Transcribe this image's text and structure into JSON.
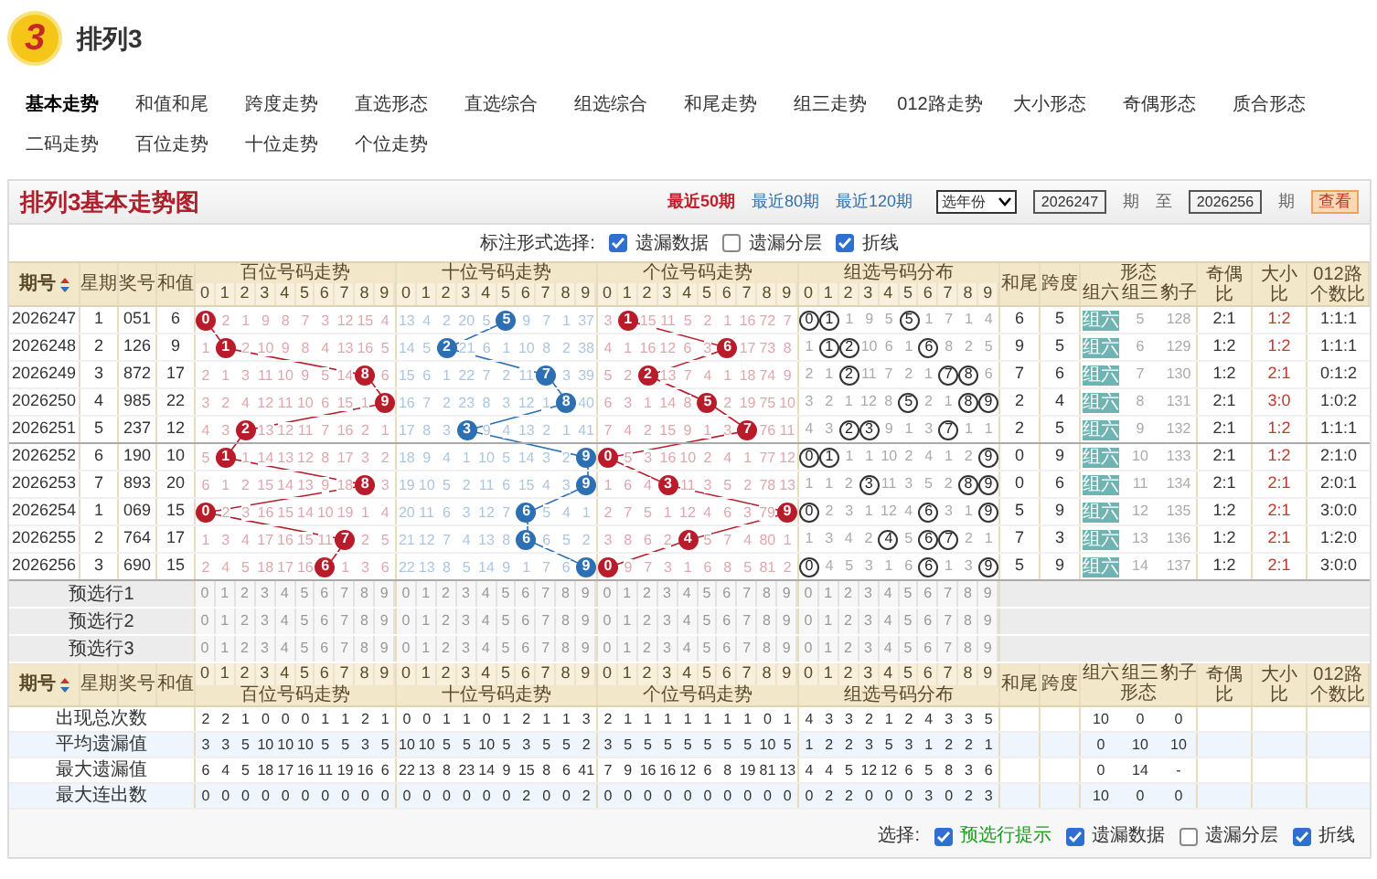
{
  "header": {
    "logo_text": "3",
    "title": "排列3"
  },
  "nav": [
    {
      "label": "基本走势",
      "selected": true
    },
    {
      "label": "和值和尾",
      "selected": false
    },
    {
      "label": "跨度走势",
      "selected": false
    },
    {
      "label": "直选形态",
      "selected": false
    },
    {
      "label": "直选综合",
      "selected": false
    },
    {
      "label": "组选综合",
      "selected": false
    },
    {
      "label": "和尾走势",
      "selected": false
    },
    {
      "label": "组三走势",
      "selected": false
    },
    {
      "label": "012路走势",
      "selected": false
    },
    {
      "label": "大小形态",
      "selected": false
    },
    {
      "label": "奇偶形态",
      "selected": false
    },
    {
      "label": "质合形态",
      "selected": false
    },
    {
      "label": "二码走势",
      "selected": false
    },
    {
      "label": "百位走势",
      "selected": false
    },
    {
      "label": "十位走势",
      "selected": false
    },
    {
      "label": "个位走势",
      "selected": false
    }
  ],
  "panel": {
    "title": "排列3基本走势图",
    "ranges": [
      {
        "label": "最近50期",
        "selected": true
      },
      {
        "label": "最近80期",
        "selected": false
      },
      {
        "label": "最近120期",
        "selected": false
      }
    ],
    "year_select": "选年份",
    "from": "2026247",
    "from_unit": "期",
    "to_label": "至",
    "to": "2026256",
    "to_unit": "期",
    "submit": "查看"
  },
  "options": {
    "label": "标注形式选择:",
    "checks": [
      {
        "label": "遗漏数据",
        "checked": true
      },
      {
        "label": "遗漏分层",
        "checked": false
      },
      {
        "label": "折线",
        "checked": true
      }
    ]
  },
  "table": {
    "columns": {
      "period": "期号",
      "weekday": "星期",
      "number": "奖号",
      "sum": "和值",
      "sections": [
        {
          "title": "百位号码走势",
          "kind": "position",
          "color": "#b81c2a",
          "digits": [
            "0",
            "1",
            "2",
            "3",
            "4",
            "5",
            "6",
            "7",
            "8",
            "9"
          ]
        },
        {
          "title": "十位号码走势",
          "kind": "position",
          "color": "#2d6fb3",
          "digits": [
            "0",
            "1",
            "2",
            "3",
            "4",
            "5",
            "6",
            "7",
            "8",
            "9"
          ]
        },
        {
          "title": "个位号码走势",
          "kind": "position",
          "color": "#b81c2a",
          "digits": [
            "0",
            "1",
            "2",
            "3",
            "4",
            "5",
            "6",
            "7",
            "8",
            "9"
          ]
        },
        {
          "title": "组选号码分布",
          "kind": "group",
          "digits": [
            "0",
            "1",
            "2",
            "3",
            "4",
            "5",
            "6",
            "7",
            "8",
            "9"
          ]
        }
      ],
      "tail": "和尾",
      "span": "跨度",
      "form": {
        "title": "形态",
        "items": [
          "组六",
          "组三",
          "豹子"
        ]
      },
      "odd_even": "奇偶比",
      "big_small": "大小比",
      "route": "012路个数比"
    },
    "rows": [
      {
        "period": "2026247",
        "weekday": "1",
        "number": "051",
        "sum": "6",
        "sections": [
          {
            "values": [
              "0",
              "2",
              "1",
              "9",
              "8",
              "7",
              "3",
              "12",
              "15",
              "4"
            ],
            "hits": [
              true,
              false,
              false,
              false,
              false,
              false,
              false,
              false,
              false,
              false
            ]
          },
          {
            "values": [
              "13",
              "4",
              "2",
              "20",
              "5",
              "5",
              "9",
              "7",
              "1",
              "37"
            ],
            "hits": [
              false,
              false,
              false,
              false,
              false,
              true,
              false,
              false,
              false,
              false
            ]
          },
          {
            "values": [
              "3",
              "1",
              "15",
              "11",
              "5",
              "2",
              "1",
              "16",
              "72",
              "7"
            ],
            "hits": [
              false,
              true,
              false,
              false,
              false,
              false,
              false,
              false,
              false,
              false
            ]
          },
          {
            "values": [
              "0",
              "1",
              "1",
              "9",
              "5",
              "5",
              "1",
              "7",
              "1",
              "4"
            ],
            "hits": [
              true,
              true,
              false,
              false,
              false,
              true,
              false,
              false,
              false,
              false
            ]
          }
        ],
        "tail": "6",
        "span": "5",
        "form": [
          {
            "text": "组六",
            "selected": true
          },
          {
            "text": "5",
            "selected": false
          },
          {
            "text": "128",
            "selected": false
          }
        ],
        "odd_even": "2:1",
        "big_small": "1:2",
        "route": "1:1:1"
      },
      {
        "period": "2026248",
        "weekday": "2",
        "number": "126",
        "sum": "9",
        "sections": [
          {
            "values": [
              "1",
              "1",
              "2",
              "10",
              "9",
              "8",
              "4",
              "13",
              "16",
              "5"
            ],
            "hits": [
              false,
              true,
              false,
              false,
              false,
              false,
              false,
              false,
              false,
              false
            ]
          },
          {
            "values": [
              "14",
              "5",
              "2",
              "21",
              "6",
              "1",
              "10",
              "8",
              "2",
              "38"
            ],
            "hits": [
              false,
              false,
              true,
              false,
              false,
              false,
              false,
              false,
              false,
              false
            ]
          },
          {
            "values": [
              "4",
              "1",
              "16",
              "12",
              "6",
              "3",
              "6",
              "17",
              "73",
              "8"
            ],
            "hits": [
              false,
              false,
              false,
              false,
              false,
              false,
              true,
              false,
              false,
              false
            ]
          },
          {
            "values": [
              "1",
              "1",
              "2",
              "10",
              "6",
              "1",
              "6",
              "8",
              "2",
              "5"
            ],
            "hits": [
              false,
              true,
              true,
              false,
              false,
              false,
              true,
              false,
              false,
              false
            ]
          }
        ],
        "tail": "9",
        "span": "5",
        "form": [
          {
            "text": "组六",
            "selected": true
          },
          {
            "text": "6",
            "selected": false
          },
          {
            "text": "129",
            "selected": false
          }
        ],
        "odd_even": "1:2",
        "big_small": "1:2",
        "route": "1:1:1"
      },
      {
        "period": "2026249",
        "weekday": "3",
        "number": "872",
        "sum": "17",
        "sections": [
          {
            "values": [
              "2",
              "1",
              "3",
              "11",
              "10",
              "9",
              "5",
              "14",
              "8",
              "6"
            ],
            "hits": [
              false,
              false,
              false,
              false,
              false,
              false,
              false,
              false,
              true,
              false
            ]
          },
          {
            "values": [
              "15",
              "6",
              "1",
              "22",
              "7",
              "2",
              "11",
              "7",
              "3",
              "39"
            ],
            "hits": [
              false,
              false,
              false,
              false,
              false,
              false,
              false,
              true,
              false,
              false
            ]
          },
          {
            "values": [
              "5",
              "2",
              "2",
              "13",
              "7",
              "4",
              "1",
              "18",
              "74",
              "9"
            ],
            "hits": [
              false,
              false,
              true,
              false,
              false,
              false,
              false,
              false,
              false,
              false
            ]
          },
          {
            "values": [
              "2",
              "1",
              "2",
              "11",
              "7",
              "2",
              "1",
              "7",
              "8",
              "6"
            ],
            "hits": [
              false,
              false,
              true,
              false,
              false,
              false,
              false,
              true,
              true,
              false
            ]
          }
        ],
        "tail": "7",
        "span": "6",
        "form": [
          {
            "text": "组六",
            "selected": true
          },
          {
            "text": "7",
            "selected": false
          },
          {
            "text": "130",
            "selected": false
          }
        ],
        "odd_even": "1:2",
        "big_small": "2:1",
        "route": "0:1:2"
      },
      {
        "period": "2026250",
        "weekday": "4",
        "number": "985",
        "sum": "22",
        "sections": [
          {
            "values": [
              "3",
              "2",
              "4",
              "12",
              "11",
              "10",
              "6",
              "15",
              "1",
              "9"
            ],
            "hits": [
              false,
              false,
              false,
              false,
              false,
              false,
              false,
              false,
              false,
              true
            ]
          },
          {
            "values": [
              "16",
              "7",
              "2",
              "23",
              "8",
              "3",
              "12",
              "1",
              "8",
              "40"
            ],
            "hits": [
              false,
              false,
              false,
              false,
              false,
              false,
              false,
              false,
              true,
              false
            ]
          },
          {
            "values": [
              "6",
              "3",
              "1",
              "14",
              "8",
              "5",
              "2",
              "19",
              "75",
              "10"
            ],
            "hits": [
              false,
              false,
              false,
              false,
              false,
              true,
              false,
              false,
              false,
              false
            ]
          },
          {
            "values": [
              "3",
              "2",
              "1",
              "12",
              "8",
              "5",
              "2",
              "1",
              "8",
              "9"
            ],
            "hits": [
              false,
              false,
              false,
              false,
              false,
              true,
              false,
              false,
              true,
              true
            ]
          }
        ],
        "tail": "2",
        "span": "4",
        "form": [
          {
            "text": "组六",
            "selected": true
          },
          {
            "text": "8",
            "selected": false
          },
          {
            "text": "131",
            "selected": false
          }
        ],
        "odd_even": "2:1",
        "big_small": "3:0",
        "route": "1:0:2"
      },
      {
        "period": "2026251",
        "weekday": "5",
        "number": "237",
        "sum": "12",
        "sections": [
          {
            "values": [
              "4",
              "3",
              "2",
              "13",
              "12",
              "11",
              "7",
              "16",
              "2",
              "1"
            ],
            "hits": [
              false,
              false,
              true,
              false,
              false,
              false,
              false,
              false,
              false,
              false
            ]
          },
          {
            "values": [
              "17",
              "8",
              "3",
              "3",
              "9",
              "4",
              "13",
              "2",
              "1",
              "41"
            ],
            "hits": [
              false,
              false,
              false,
              true,
              false,
              false,
              false,
              false,
              false,
              false
            ]
          },
          {
            "values": [
              "7",
              "4",
              "2",
              "15",
              "9",
              "1",
              "3",
              "7",
              "76",
              "11"
            ],
            "hits": [
              false,
              false,
              false,
              false,
              false,
              false,
              false,
              true,
              false,
              false
            ]
          },
          {
            "values": [
              "4",
              "3",
              "2",
              "3",
              "9",
              "1",
              "3",
              "7",
              "1",
              "1"
            ],
            "hits": [
              false,
              false,
              true,
              true,
              false,
              false,
              false,
              true,
              false,
              false
            ]
          }
        ],
        "tail": "2",
        "span": "5",
        "form": [
          {
            "text": "组六",
            "selected": true
          },
          {
            "text": "9",
            "selected": false
          },
          {
            "text": "132",
            "selected": false
          }
        ],
        "odd_even": "2:1",
        "big_small": "1:2",
        "route": "1:1:1"
      },
      {
        "period": "2026252",
        "weekday": "6",
        "number": "190",
        "sum": "10",
        "sections": [
          {
            "values": [
              "5",
              "1",
              "1",
              "14",
              "13",
              "12",
              "8",
              "17",
              "3",
              "2"
            ],
            "hits": [
              false,
              true,
              false,
              false,
              false,
              false,
              false,
              false,
              false,
              false
            ]
          },
          {
            "values": [
              "18",
              "9",
              "4",
              "1",
              "10",
              "5",
              "14",
              "3",
              "2",
              "9"
            ],
            "hits": [
              false,
              false,
              false,
              false,
              false,
              false,
              false,
              false,
              false,
              true
            ]
          },
          {
            "values": [
              "0",
              "5",
              "3",
              "16",
              "10",
              "2",
              "4",
              "1",
              "77",
              "12"
            ],
            "hits": [
              true,
              false,
              false,
              false,
              false,
              false,
              false,
              false,
              false,
              false
            ]
          },
          {
            "values": [
              "0",
              "1",
              "1",
              "1",
              "10",
              "2",
              "4",
              "1",
              "2",
              "9"
            ],
            "hits": [
              true,
              true,
              false,
              false,
              false,
              false,
              false,
              false,
              false,
              true
            ]
          }
        ],
        "tail": "0",
        "span": "9",
        "form": [
          {
            "text": "组六",
            "selected": true
          },
          {
            "text": "10",
            "selected": false
          },
          {
            "text": "133",
            "selected": false
          }
        ],
        "odd_even": "2:1",
        "big_small": "1:2",
        "route": "2:1:0"
      },
      {
        "period": "2026253",
        "weekday": "7",
        "number": "893",
        "sum": "20",
        "sections": [
          {
            "values": [
              "6",
              "1",
              "2",
              "15",
              "14",
              "13",
              "9",
              "18",
              "8",
              "3"
            ],
            "hits": [
              false,
              false,
              false,
              false,
              false,
              false,
              false,
              false,
              true,
              false
            ]
          },
          {
            "values": [
              "19",
              "10",
              "5",
              "2",
              "11",
              "6",
              "15",
              "4",
              "3",
              "9"
            ],
            "hits": [
              false,
              false,
              false,
              false,
              false,
              false,
              false,
              false,
              false,
              true
            ]
          },
          {
            "values": [
              "1",
              "6",
              "4",
              "3",
              "11",
              "3",
              "5",
              "2",
              "78",
              "13"
            ],
            "hits": [
              false,
              false,
              false,
              true,
              false,
              false,
              false,
              false,
              false,
              false
            ]
          },
          {
            "values": [
              "1",
              "1",
              "2",
              "3",
              "11",
              "3",
              "5",
              "2",
              "8",
              "9"
            ],
            "hits": [
              false,
              false,
              false,
              true,
              false,
              false,
              false,
              false,
              true,
              true
            ]
          }
        ],
        "tail": "0",
        "span": "6",
        "form": [
          {
            "text": "组六",
            "selected": true
          },
          {
            "text": "11",
            "selected": false
          },
          {
            "text": "134",
            "selected": false
          }
        ],
        "odd_even": "2:1",
        "big_small": "2:1",
        "route": "2:0:1"
      },
      {
        "period": "2026254",
        "weekday": "1",
        "number": "069",
        "sum": "15",
        "sections": [
          {
            "values": [
              "0",
              "2",
              "3",
              "16",
              "15",
              "14",
              "10",
              "19",
              "1",
              "4"
            ],
            "hits": [
              true,
              false,
              false,
              false,
              false,
              false,
              false,
              false,
              false,
              false
            ]
          },
          {
            "values": [
              "20",
              "11",
              "6",
              "3",
              "12",
              "7",
              "6",
              "5",
              "4",
              "1"
            ],
            "hits": [
              false,
              false,
              false,
              false,
              false,
              false,
              true,
              false,
              false,
              false
            ]
          },
          {
            "values": [
              "2",
              "7",
              "5",
              "1",
              "12",
              "4",
              "6",
              "3",
              "79",
              "9"
            ],
            "hits": [
              false,
              false,
              false,
              false,
              false,
              false,
              false,
              false,
              false,
              true
            ]
          },
          {
            "values": [
              "0",
              "2",
              "3",
              "1",
              "12",
              "4",
              "6",
              "3",
              "1",
              "9"
            ],
            "hits": [
              true,
              false,
              false,
              false,
              false,
              false,
              true,
              false,
              false,
              true
            ]
          }
        ],
        "tail": "5",
        "span": "9",
        "form": [
          {
            "text": "组六",
            "selected": true
          },
          {
            "text": "12",
            "selected": false
          },
          {
            "text": "135",
            "selected": false
          }
        ],
        "odd_even": "1:2",
        "big_small": "2:1",
        "route": "3:0:0"
      },
      {
        "period": "2026255",
        "weekday": "2",
        "number": "764",
        "sum": "17",
        "sections": [
          {
            "values": [
              "1",
              "3",
              "4",
              "17",
              "16",
              "15",
              "11",
              "7",
              "2",
              "5"
            ],
            "hits": [
              false,
              false,
              false,
              false,
              false,
              false,
              false,
              true,
              false,
              false
            ]
          },
          {
            "values": [
              "21",
              "12",
              "7",
              "4",
              "13",
              "8",
              "6",
              "6",
              "5",
              "2"
            ],
            "hits": [
              false,
              false,
              false,
              false,
              false,
              false,
              true,
              false,
              false,
              false
            ]
          },
          {
            "values": [
              "3",
              "8",
              "6",
              "2",
              "4",
              "5",
              "7",
              "4",
              "80",
              "1"
            ],
            "hits": [
              false,
              false,
              false,
              false,
              true,
              false,
              false,
              false,
              false,
              false
            ]
          },
          {
            "values": [
              "1",
              "3",
              "4",
              "2",
              "4",
              "5",
              "6",
              "7",
              "2",
              "1"
            ],
            "hits": [
              false,
              false,
              false,
              false,
              true,
              false,
              true,
              true,
              false,
              false
            ]
          }
        ],
        "tail": "7",
        "span": "3",
        "form": [
          {
            "text": "组六",
            "selected": true
          },
          {
            "text": "13",
            "selected": false
          },
          {
            "text": "136",
            "selected": false
          }
        ],
        "odd_even": "1:2",
        "big_small": "2:1",
        "route": "1:2:0"
      },
      {
        "period": "2026256",
        "weekday": "3",
        "number": "690",
        "sum": "15",
        "sections": [
          {
            "values": [
              "2",
              "4",
              "5",
              "18",
              "17",
              "16",
              "6",
              "1",
              "3",
              "6"
            ],
            "hits": [
              false,
              false,
              false,
              false,
              false,
              false,
              true,
              false,
              false,
              false
            ]
          },
          {
            "values": [
              "22",
              "13",
              "8",
              "5",
              "14",
              "9",
              "1",
              "7",
              "6",
              "9"
            ],
            "hits": [
              false,
              false,
              false,
              false,
              false,
              false,
              false,
              false,
              false,
              true
            ]
          },
          {
            "values": [
              "0",
              "9",
              "7",
              "3",
              "1",
              "6",
              "8",
              "5",
              "81",
              "2"
            ],
            "hits": [
              true,
              false,
              false,
              false,
              false,
              false,
              false,
              false,
              false,
              false
            ]
          },
          {
            "values": [
              "0",
              "4",
              "5",
              "3",
              "1",
              "6",
              "6",
              "1",
              "3",
              "9"
            ],
            "hits": [
              true,
              false,
              false,
              false,
              false,
              false,
              true,
              false,
              false,
              true
            ]
          }
        ],
        "tail": "5",
        "span": "9",
        "form": [
          {
            "text": "组六",
            "selected": true
          },
          {
            "text": "14",
            "selected": false
          },
          {
            "text": "137",
            "selected": false
          }
        ],
        "odd_even": "1:2",
        "big_small": "2:1",
        "route": "3:0:0"
      }
    ],
    "preselect_rows": [
      {
        "label": "预选行1",
        "sections": [
          [
            "0",
            "1",
            "2",
            "3",
            "4",
            "5",
            "6",
            "7",
            "8",
            "9"
          ],
          [
            "0",
            "1",
            "2",
            "3",
            "4",
            "5",
            "6",
            "7",
            "8",
            "9"
          ],
          [
            "0",
            "1",
            "2",
            "3",
            "4",
            "5",
            "6",
            "7",
            "8",
            "9"
          ],
          [
            "0",
            "1",
            "2",
            "3",
            "4",
            "5",
            "6",
            "7",
            "8",
            "9"
          ]
        ]
      },
      {
        "label": "预选行2",
        "sections": [
          [
            "0",
            "1",
            "2",
            "3",
            "4",
            "5",
            "6",
            "7",
            "8",
            "9"
          ],
          [
            "0",
            "1",
            "2",
            "3",
            "4",
            "5",
            "6",
            "7",
            "8",
            "9"
          ],
          [
            "0",
            "1",
            "2",
            "3",
            "4",
            "5",
            "6",
            "7",
            "8",
            "9"
          ],
          [
            "0",
            "1",
            "2",
            "3",
            "4",
            "5",
            "6",
            "7",
            "8",
            "9"
          ]
        ]
      },
      {
        "label": "预选行3",
        "sections": [
          [
            "0",
            "1",
            "2",
            "3",
            "4",
            "5",
            "6",
            "7",
            "8",
            "9"
          ],
          [
            "0",
            "1",
            "2",
            "3",
            "4",
            "5",
            "6",
            "7",
            "8",
            "9"
          ],
          [
            "0",
            "1",
            "2",
            "3",
            "4",
            "5",
            "6",
            "7",
            "8",
            "9"
          ],
          [
            "0",
            "1",
            "2",
            "3",
            "4",
            "5",
            "6",
            "7",
            "8",
            "9"
          ]
        ]
      }
    ],
    "footer_columns": {
      "period": "期号",
      "weekday": "星期",
      "number": "奖号",
      "sum": "和值",
      "sections": [
        {
          "title": "百位号码走势",
          "digits": [
            "0",
            "1",
            "2",
            "3",
            "4",
            "5",
            "6",
            "7",
            "8",
            "9"
          ]
        },
        {
          "title": "十位号码走势",
          "digits": [
            "0",
            "1",
            "2",
            "3",
            "4",
            "5",
            "6",
            "7",
            "8",
            "9"
          ]
        },
        {
          "title": "个位号码走势",
          "digits": [
            "0",
            "1",
            "2",
            "3",
            "4",
            "5",
            "6",
            "7",
            "8",
            "9"
          ]
        },
        {
          "title": "组选号码分布",
          "digits": [
            "0",
            "1",
            "2",
            "3",
            "4",
            "5",
            "6",
            "7",
            "8",
            "9"
          ]
        }
      ],
      "tail": "和尾",
      "span": "跨度",
      "form": {
        "title": "形态",
        "items": [
          "组六",
          "组三",
          "豹子"
        ]
      },
      "odd_even": "奇偶比",
      "big_small": "大小比",
      "route": "012路个数比"
    },
    "stats": [
      {
        "label": "出现总次数",
        "sections": [
          [
            "2",
            "2",
            "1",
            "0",
            "0",
            "0",
            "1",
            "1",
            "2",
            "1"
          ],
          [
            "0",
            "0",
            "1",
            "1",
            "0",
            "1",
            "2",
            "1",
            "1",
            "3"
          ],
          [
            "2",
            "1",
            "1",
            "1",
            "1",
            "1",
            "1",
            "1",
            "0",
            "1"
          ],
          [
            "4",
            "3",
            "3",
            "2",
            "1",
            "2",
            "4",
            "3",
            "3",
            "5"
          ]
        ],
        "form": [
          "10",
          "0",
          "0"
        ]
      },
      {
        "label": "平均遗漏值",
        "sections": [
          [
            "3",
            "3",
            "5",
            "10",
            "10",
            "10",
            "5",
            "5",
            "3",
            "5"
          ],
          [
            "10",
            "10",
            "5",
            "5",
            "10",
            "5",
            "3",
            "5",
            "5",
            "2"
          ],
          [
            "3",
            "5",
            "5",
            "5",
            "5",
            "5",
            "5",
            "5",
            "10",
            "5"
          ],
          [
            "1",
            "2",
            "2",
            "3",
            "5",
            "3",
            "1",
            "2",
            "2",
            "1"
          ]
        ],
        "form": [
          "0",
          "10",
          "10"
        ]
      },
      {
        "label": "最大遗漏值",
        "sections": [
          [
            "6",
            "4",
            "5",
            "18",
            "17",
            "16",
            "11",
            "19",
            "16",
            "6"
          ],
          [
            "22",
            "13",
            "8",
            "23",
            "14",
            "9",
            "15",
            "8",
            "6",
            "41"
          ],
          [
            "7",
            "9",
            "16",
            "16",
            "12",
            "6",
            "8",
            "19",
            "81",
            "13"
          ],
          [
            "4",
            "4",
            "5",
            "12",
            "12",
            "6",
            "5",
            "8",
            "3",
            "6"
          ]
        ],
        "form": [
          "0",
          "14",
          "-"
        ]
      },
      {
        "label": "最大连出数",
        "sections": [
          [
            "0",
            "0",
            "0",
            "0",
            "0",
            "0",
            "0",
            "0",
            "0",
            "0"
          ],
          [
            "0",
            "0",
            "0",
            "0",
            "0",
            "0",
            "2",
            "0",
            "0",
            "2"
          ],
          [
            "0",
            "0",
            "0",
            "0",
            "0",
            "0",
            "0",
            "0",
            "0",
            "0"
          ],
          [
            "0",
            "2",
            "2",
            "0",
            "0",
            "0",
            "3",
            "0",
            "2",
            "3"
          ]
        ],
        "form": [
          "10",
          "0",
          "0"
        ]
      }
    ]
  },
  "footer_options": {
    "label": "选择:",
    "checks": [
      {
        "label": "预选行提示",
        "checked": true,
        "kind": "hint"
      },
      {
        "label": "遗漏数据",
        "checked": true,
        "kind": "plain"
      },
      {
        "label": "遗漏分层",
        "checked": false,
        "kind": "plain"
      },
      {
        "label": "折线",
        "checked": true,
        "kind": "plain"
      }
    ]
  }
}
